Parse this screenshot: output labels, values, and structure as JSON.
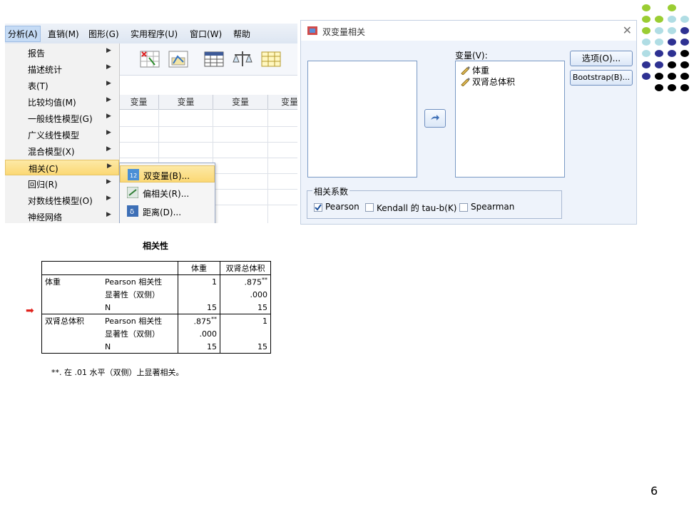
{
  "menubar": {
    "items": [
      "分析(A)",
      "直销(M)",
      "图形(G)",
      "实用程序(U)",
      "窗口(W)",
      "帮助"
    ]
  },
  "analyze_menu": {
    "items": [
      "报告",
      "描述统计",
      "表(T)",
      "比较均值(M)",
      "一般线性模型(G)",
      "广义线性模型",
      "混合模型(X)",
      "相关(C)",
      "回归(R)",
      "对数线性模型(O)",
      "神经网络"
    ],
    "highlighted": "相关(C)"
  },
  "correlate_submenu": {
    "items": [
      "双变量(B)...",
      "偏相关(R)...",
      "距离(D)..."
    ],
    "highlighted": "双变量(B)..."
  },
  "sheet": {
    "column_label": "变量"
  },
  "dialog": {
    "title": "双变量相关",
    "variables_label": "变量(V):",
    "variables": [
      "体重",
      "双肾总体积"
    ],
    "options_button": "选项(O)...",
    "bootstrap_button": "Bootstrap(B)...",
    "coef_group_label": "相关系数",
    "pearson": {
      "label": "Pearson",
      "checked": true
    },
    "kendall": {
      "label": "Kendall 的 tau-b(K)",
      "checked": false
    },
    "spearman": {
      "label": "Spearman",
      "checked": false
    }
  },
  "output_table": {
    "title": "相关性",
    "headers": [
      "",
      "",
      "体重",
      "双肾总体积"
    ],
    "rows": [
      [
        "体重",
        "Pearson 相关性",
        "1",
        ".875"
      ],
      [
        "",
        "显著性（双侧）",
        "",
        ".000"
      ],
      [
        "",
        "N",
        "15",
        "15"
      ],
      [
        "双肾总体积",
        "Pearson 相关性",
        ".875",
        "1"
      ],
      [
        "",
        "显著性（双侧）",
        ".000",
        ""
      ],
      [
        "",
        "N",
        "15",
        "15"
      ]
    ],
    "sig_mark": "**",
    "footnote": "**. 在 .01 水平（双侧）上显著相关。"
  },
  "page_number": "6",
  "colors": {
    "green_dot": "#9acd32",
    "lightblue_dot": "#b0dde4",
    "navy_dot": "#2e3192",
    "black_dot": "#000000",
    "highlight": "#fbd874",
    "arrow": "#e0221c"
  }
}
